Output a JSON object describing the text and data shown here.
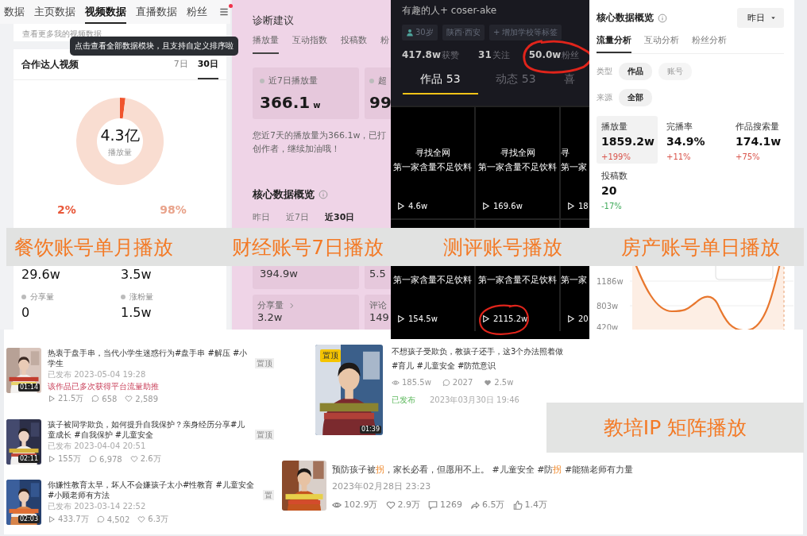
{
  "creator_video_panel": {
    "tabs": [
      {
        "label": "数据",
        "selected": false
      },
      {
        "label": "主页数据",
        "selected": false
      },
      {
        "label": "视频数据",
        "selected": true
      },
      {
        "label": "直播数据",
        "selected": false
      },
      {
        "label": "粉丝",
        "selected": false
      }
    ],
    "menu_badge": true,
    "more_link": "查看更多我的视频数据",
    "tooltip": "点击查看全部数据模块，且支持自定义排序啦",
    "card_title": "合作达人视频",
    "periods": [
      {
        "label": "7日",
        "selected": false
      },
      {
        "label": "30日",
        "selected": true
      }
    ],
    "chart_data": {
      "type": "donut",
      "values": [
        2,
        98
      ]
    },
    "center_value": "4.3亿",
    "center_label": "播放量",
    "shares": [
      {
        "value": "2%",
        "color": "#e8583a"
      },
      {
        "value": "98%",
        "color": "#e9a48c"
      }
    ],
    "metrics": [
      {
        "value": "29.6w"
      },
      {
        "value": "3.5w"
      },
      {
        "label": "分享量",
        "value": "0"
      },
      {
        "label": "涨粉量",
        "value": "1.5w"
      }
    ]
  },
  "finance_panel": {
    "title": "诊断建议",
    "tabs": [
      {
        "label": "播放量",
        "selected": true
      },
      {
        "label": "互动指数",
        "selected": false
      },
      {
        "label": "投稿数",
        "selected": false
      },
      {
        "label": "粉",
        "selected": false
      }
    ],
    "highlights": [
      {
        "label": "近7日播放量",
        "value": "366.1",
        "unit": "w"
      },
      {
        "label": "超",
        "value": "99"
      }
    ],
    "advice": [
      "您近7天的播放量为366.1w，已打",
      "创作者，继续加油哦！"
    ],
    "overview_title": "核心数据概览",
    "periods": [
      {
        "label": "昨日",
        "selected": false
      },
      {
        "label": "近7日",
        "selected": false
      },
      {
        "label": "近30日",
        "selected": true
      }
    ],
    "metrics": [
      {
        "value": "394.9w"
      },
      {
        "value": "5.5"
      },
      {
        "label": "分享量",
        "value": "3.2w",
        "arrow": true
      },
      {
        "label": "评论",
        "value": "149",
        "arrow": false
      }
    ]
  },
  "review_panel": {
    "name": "有趣的人+ coser-ake",
    "tags": [
      {
        "kind": "age",
        "text": "30岁"
      },
      {
        "kind": "place",
        "text": "陕西·西安"
      },
      {
        "kind": "add",
        "text": "+ 增加学校等标签"
      }
    ],
    "stats": [
      {
        "value": "417.8w",
        "label": "获赞",
        "circled": false
      },
      {
        "value": "31",
        "label": "关注",
        "circled": false
      },
      {
        "value": "50.0w",
        "label": "粉丝",
        "circled": true
      }
    ],
    "tabs": [
      {
        "label": "作品 53",
        "selected": true
      },
      {
        "label": "动态 53",
        "selected": false
      },
      {
        "label": "喜",
        "selected": false
      }
    ],
    "videos": [
      {
        "lines": [
          "寻找全网",
          "第一家含量不足饮料"
        ],
        "plays": "4.6w",
        "circled": false
      },
      {
        "lines": [
          "寻找全网",
          "第一家含量不足饮料"
        ],
        "plays": "169.6w",
        "circled": false
      },
      {
        "lines": [
          "寻",
          "第一家"
        ],
        "plays": "18",
        "circled": false
      },
      {
        "lines": [
          "第一家含量不足饮料"
        ],
        "plays": "154.5w",
        "circled": false
      },
      {
        "lines": [
          "第一家含量不足饮料"
        ],
        "plays": "2115.2w",
        "circled": true
      },
      {
        "lines": [
          "第一家"
        ],
        "plays": "20",
        "circled": false
      }
    ]
  },
  "property_panel": {
    "title": "核心数据概览",
    "range": "昨日",
    "tabs": [
      {
        "label": "流量分析",
        "selected": true
      },
      {
        "label": "互动分析",
        "selected": false
      },
      {
        "label": "粉丝分析",
        "selected": false
      }
    ],
    "filters": [
      {
        "label": "类型",
        "options": [
          {
            "label": "作品",
            "selected": true
          },
          {
            "label": "账号",
            "selected": false
          }
        ]
      },
      {
        "label": "来源",
        "options": [
          {
            "label": "全部",
            "selected": true
          }
        ]
      }
    ],
    "metrics": [
      {
        "label": "播放量",
        "value": "1859.2w",
        "change": "+199%",
        "color": "#d9534a",
        "selected": true
      },
      {
        "label": "完播率",
        "value": "34.9%",
        "change": "+11%",
        "color": "#d9534a",
        "selected": false
      },
      {
        "label": "作品搜索量",
        "value": "174.1w",
        "change": "+75%",
        "color": "#d9534a",
        "selected": false
      },
      {
        "label": "投稿数",
        "value": "20",
        "change": "-17%",
        "color": "#3faa5a",
        "selected": false
      }
    ],
    "chart_ticks": [
      "1186w",
      "803w",
      "420w"
    ]
  },
  "captions": [
    "餐饮账号单月播放",
    "财经账号7日播放",
    "测评账号播放",
    "房产账号单日播放"
  ],
  "video_list": [
    {
      "title": "热衷于盘手串，当代小学生迷惑行为#盘手串 #解压 #小学生",
      "pinned": "置顶",
      "published": "已发布 2023-05-04 19:28",
      "notice": "该作品已多次获得平台流量助推",
      "duration": "01:14",
      "stats": [
        {
          "kind": "play",
          "value": "21.5万"
        },
        {
          "kind": "comment",
          "value": "658"
        },
        {
          "kind": "like",
          "value": "2,589"
        }
      ]
    },
    {
      "title": "孩子被同学欺负，如何提升自我保护？亲身经历分享#儿童成长 #自我保护 #儿童安全",
      "pinned": "置顶",
      "published": "已发布 2023-04-04 20:51",
      "duration": "02:11",
      "stats": [
        {
          "kind": "play",
          "value": "155万"
        },
        {
          "kind": "comment",
          "value": "6,978"
        },
        {
          "kind": "like",
          "value": "2.6万"
        }
      ]
    },
    {
      "title": "你嫌性教育太早，坏人不会嫌孩子太小#性教育 #儿童安全 #小顾老师有方法",
      "pinned": "置",
      "published": "已发布 2023-03-14 22:52",
      "duration": "02:03",
      "stats": [
        {
          "kind": "play",
          "value": "433.7万"
        },
        {
          "kind": "comment",
          "value": "4,502"
        },
        {
          "kind": "like",
          "value": "6.3万"
        }
      ]
    }
  ],
  "featured_video": {
    "badge": "置顶",
    "duration": "01:39",
    "title": "不想孩子受欺负，教孩子还手，这3个办法照着做",
    "tags": "#育儿 #儿童安全 #防范意识",
    "stats": [
      {
        "kind": "view",
        "value": "185.5w"
      },
      {
        "kind": "comment",
        "value": "2027"
      },
      {
        "kind": "heart",
        "value": "2.5w"
      }
    ],
    "status": "已发布",
    "date": "2023年03月30日 19:46"
  },
  "matrix_caption": "教培IP 矩阵播放",
  "latest_video": {
    "title": [
      {
        "text": "预防孩子被",
        "highlight": false
      },
      {
        "text": "拐",
        "highlight": true
      },
      {
        "text": "，家长必看，但愿用不上。 #儿童安全 #防",
        "highlight": false
      },
      {
        "text": "拐",
        "highlight": true
      },
      {
        "text": " #能猫老师有力量",
        "highlight": false
      }
    ],
    "date": "2023年02月28日 23:23",
    "stats": [
      {
        "kind": "view",
        "value": "102.9万"
      },
      {
        "kind": "like",
        "value": "2.9万"
      },
      {
        "kind": "comment-box",
        "value": "1269"
      },
      {
        "kind": "share",
        "value": "6.5万"
      },
      {
        "kind": "thumb",
        "value": "1.4万"
      }
    ]
  }
}
